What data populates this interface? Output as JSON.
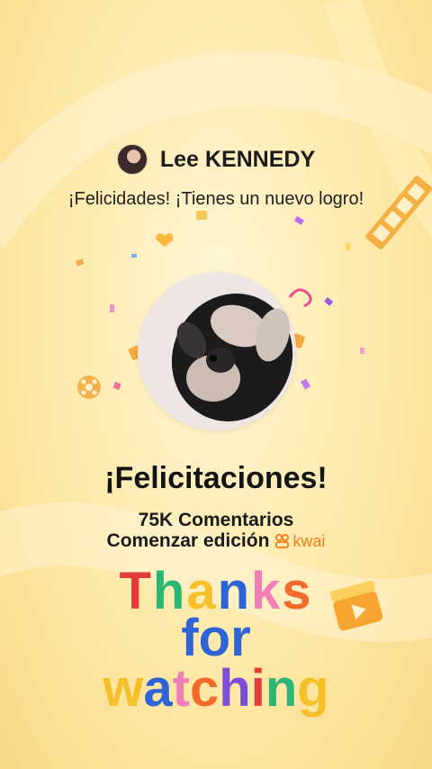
{
  "profile": {
    "username": "Lee KENNEDY"
  },
  "subtitle": "¡Felicidades! ¡Tienes un nuevo logro!",
  "congrats": "¡Felicitaciones!",
  "stat_line": "75K Comentarios",
  "edit_line": "Comenzar edición",
  "brand_name": "kwai",
  "thanks": {
    "line1": "Thanks",
    "line2": "for",
    "line3": "watching"
  },
  "colors": {
    "accent": "#ff7a1a",
    "background": "#fde9a8"
  },
  "icons": [
    "film-strip-icon",
    "film-reel-icon",
    "clapperboard-icon",
    "heart-icon",
    "gift-icon"
  ]
}
